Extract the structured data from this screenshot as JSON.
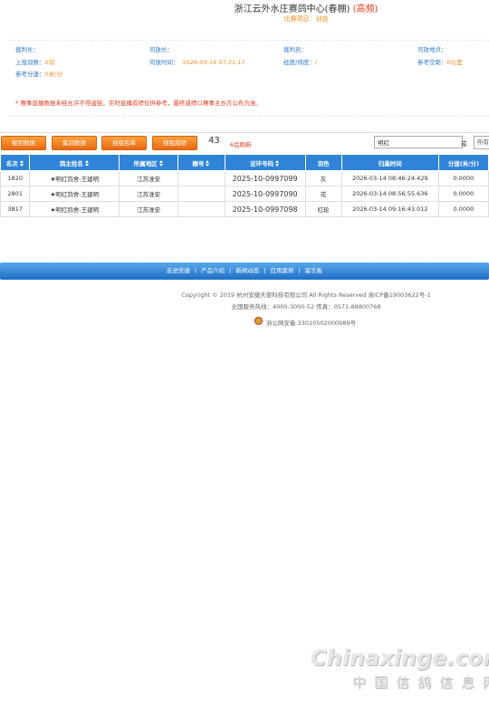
{
  "race": {
    "title": "浙江云外水庄赛鸽中心(春棚)",
    "title_tag": "(高频)",
    "project_label": "比赛项目：",
    "project_value": "训放"
  },
  "info": {
    "judge_chief": "裁判长：",
    "release_chief": "司放长：",
    "judge": "裁判员：",
    "release_site": "司放地点：",
    "basket_label": "上笼羽数：",
    "basket_value": "0羽",
    "release_time_label": "司放时间：",
    "release_time_value": "2026-03-14 07:31:17",
    "coords_label": "经度/纬度：",
    "coords_value": "/",
    "distance_label": "参考空距：",
    "distance_value": "0公里",
    "speed_label": "参考分速：",
    "speed_value": "0米/分"
  },
  "notice": "* 赛事直播数据未经允许不得盗链。实时直播成绩仅供参考，最终成绩以赛事主办方公布为准。",
  "toolbar": {
    "report_label": "报到数据",
    "collect_label": "集鸽数据",
    "group_list_label": "插组名单",
    "group_result_label": "插组成绩",
    "count": "43",
    "refresh": "6后刷新",
    "search_value": "明红",
    "or_label": "或",
    "select_value": "所有"
  },
  "table": {
    "headers": [
      "名次",
      "鸽主姓名",
      "所属地区",
      "棚号",
      "足环号码",
      "羽色",
      "归巢时间",
      "分速(米/分)"
    ],
    "rows": [
      [
        "1820",
        "★明红鸽舍-王建明",
        "江苏淮安",
        "",
        "2025-10-0997099",
        "灰",
        "2026-03-14 08:46:24.429",
        "0.0000"
      ],
      [
        "2801",
        "★明红鸽舍-王建明",
        "江苏淮安",
        "",
        "2025-10-0997090",
        "花",
        "2026-03-14 08:56:55.636",
        "0.0000"
      ],
      [
        "3817",
        "★明红鸽舍-王建明",
        "江苏淮安",
        "",
        "2025-10-0997098",
        "红轮",
        "2026-03-14 09:16:43.012",
        "0.0000"
      ]
    ]
  },
  "nav": {
    "items": [
      "走进安捷",
      "产品介绍",
      "新闻动态",
      "应用案例",
      "留言板"
    ],
    "separator": "|"
  },
  "footer": {
    "copyright": "Copyright © 2019 杭州安捷天使科技有限公司 All Rights Reserved 浙ICP备19003622号-1",
    "hotline": "全国服务热线：4000-3000-52 传真：0571-88800768",
    "police_record": "浙公网安备 33010502000989号",
    "police_icon": "police-badge-icon"
  },
  "watermark": {
    "line1": "Chinaxinge.com",
    "line2": "中国信鸽信息网"
  },
  "colors": {
    "accent_blue": "#2f84d8",
    "orange": "#f08a1c",
    "red": "#e23b1e"
  }
}
